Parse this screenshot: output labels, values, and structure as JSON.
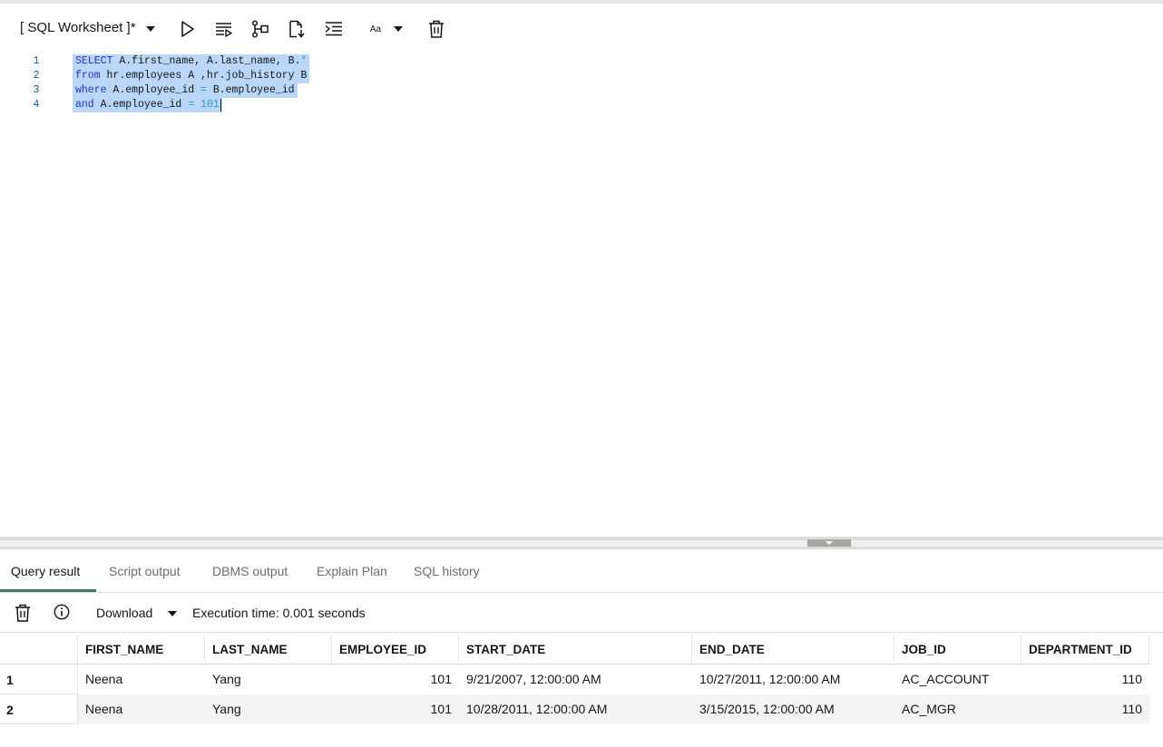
{
  "toolbar": {
    "title": "[ SQL Worksheet ]*",
    "icons": [
      "dropdown-caret",
      "run-statement-icon",
      "run-script-icon",
      "explain-plan-icon",
      "autotrace-icon",
      "format-icon",
      "text-case-icon",
      "clear-icon"
    ],
    "text_case_label": "Aa"
  },
  "editor": {
    "lines": [
      {
        "num": "1",
        "tokens": [
          {
            "t": "SELECT",
            "c": "kw"
          },
          {
            "t": " A.first_name, A.last_name, B.",
            "c": "id"
          },
          {
            "t": "*",
            "c": "op"
          }
        ]
      },
      {
        "num": "2",
        "tokens": [
          {
            "t": "from",
            "c": "kw"
          },
          {
            "t": " hr.employees A ,hr.job_history B",
            "c": "id"
          }
        ]
      },
      {
        "num": "3",
        "tokens": [
          {
            "t": "where",
            "c": "kw"
          },
          {
            "t": " A.employee_id ",
            "c": "id"
          },
          {
            "t": "=",
            "c": "op"
          },
          {
            "t": " B.employee_id",
            "c": "id"
          }
        ]
      },
      {
        "num": "4",
        "tokens": [
          {
            "t": "and",
            "c": "kw"
          },
          {
            "t": " A.employee_id ",
            "c": "id"
          },
          {
            "t": "=",
            "c": "op"
          },
          {
            "t": " ",
            "c": "id"
          },
          {
            "t": "101",
            "c": "num"
          }
        ]
      }
    ]
  },
  "tabs": {
    "items": [
      "Query result",
      "Script output",
      "DBMS output",
      "Explain Plan",
      "SQL history"
    ],
    "active": "Query result"
  },
  "result_toolbar": {
    "download_label": "Download",
    "execution_time": "Execution time: 0.001 seconds"
  },
  "grid": {
    "columns": [
      "FIRST_NAME",
      "LAST_NAME",
      "EMPLOYEE_ID",
      "START_DATE",
      "END_DATE",
      "JOB_ID",
      "DEPARTMENT_ID"
    ],
    "rows": [
      {
        "row_num": "1",
        "cells": [
          "Neena",
          "Yang",
          "101",
          "9/21/2007, 12:00:00 AM",
          "10/27/2011, 12:00:00 AM",
          "AC_ACCOUNT",
          "110"
        ]
      },
      {
        "row_num": "2",
        "cells": [
          "Neena",
          "Yang",
          "101",
          "10/28/2011, 12:00:00 AM",
          "3/15/2015, 12:00:00 AM",
          "AC_MGR",
          "110"
        ]
      }
    ]
  },
  "colors": {
    "selection": "#bad6f8",
    "keyword": "#1e36c9",
    "active_tab_underline": "#3a7d5e",
    "alt_row": "#f5f4f2"
  }
}
